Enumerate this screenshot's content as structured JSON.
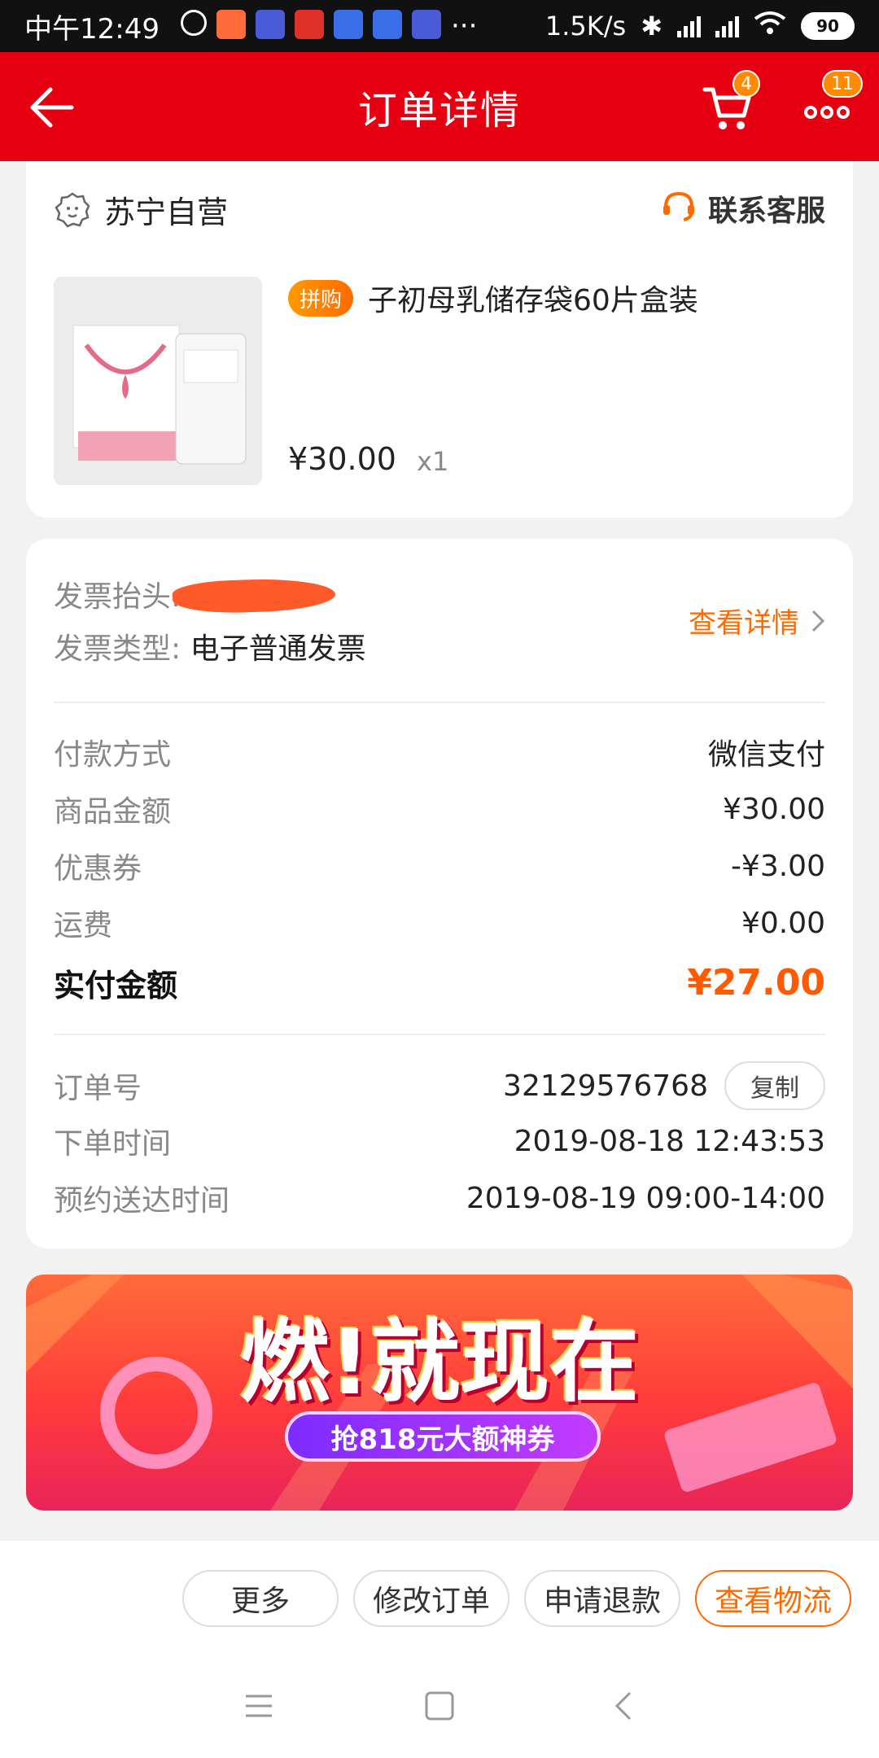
{
  "status_bar": {
    "time": "中午12:49",
    "net_speed": "1.5K/s",
    "battery": "90"
  },
  "header": {
    "title": "订单详情",
    "cart_badge": "4",
    "more_badge": "11"
  },
  "store": {
    "name": "苏宁自营",
    "service_label": "联系客服"
  },
  "product": {
    "tag": "拼购",
    "name": "子初母乳储存袋60片盒装",
    "price": "¥30.00",
    "quantity": "x1"
  },
  "invoice": {
    "title_label": "发票抬头:",
    "type_label": "发票类型:",
    "type_value": "电子普通发票",
    "detail_link": "查看详情"
  },
  "payment": {
    "method_label": "付款方式",
    "method_value": "微信支付",
    "goods_label": "商品金额",
    "goods_value": "¥30.00",
    "coupon_label": "优惠券",
    "coupon_value": "-¥3.00",
    "shipping_label": "运费",
    "shipping_value": "¥0.00",
    "total_label": "实付金额",
    "total_value": "¥27.00"
  },
  "order": {
    "number_label": "订单号",
    "number_value": "32129576768",
    "copy_label": "复制",
    "time_label": "下单时间",
    "time_value": "2019-08-18 12:43:53",
    "delivery_label": "预约送达时间",
    "delivery_value": "2019-08-19 09:00-14:00"
  },
  "banner": {
    "title": "燃!就现在",
    "subtitle": "抢818元大额神券"
  },
  "actions": {
    "more": "更多",
    "modify": "修改订单",
    "refund": "申请退款",
    "logistics": "查看物流"
  },
  "colors": {
    "brand_red": "#e60012",
    "accent_orange": "#ff6a00"
  }
}
